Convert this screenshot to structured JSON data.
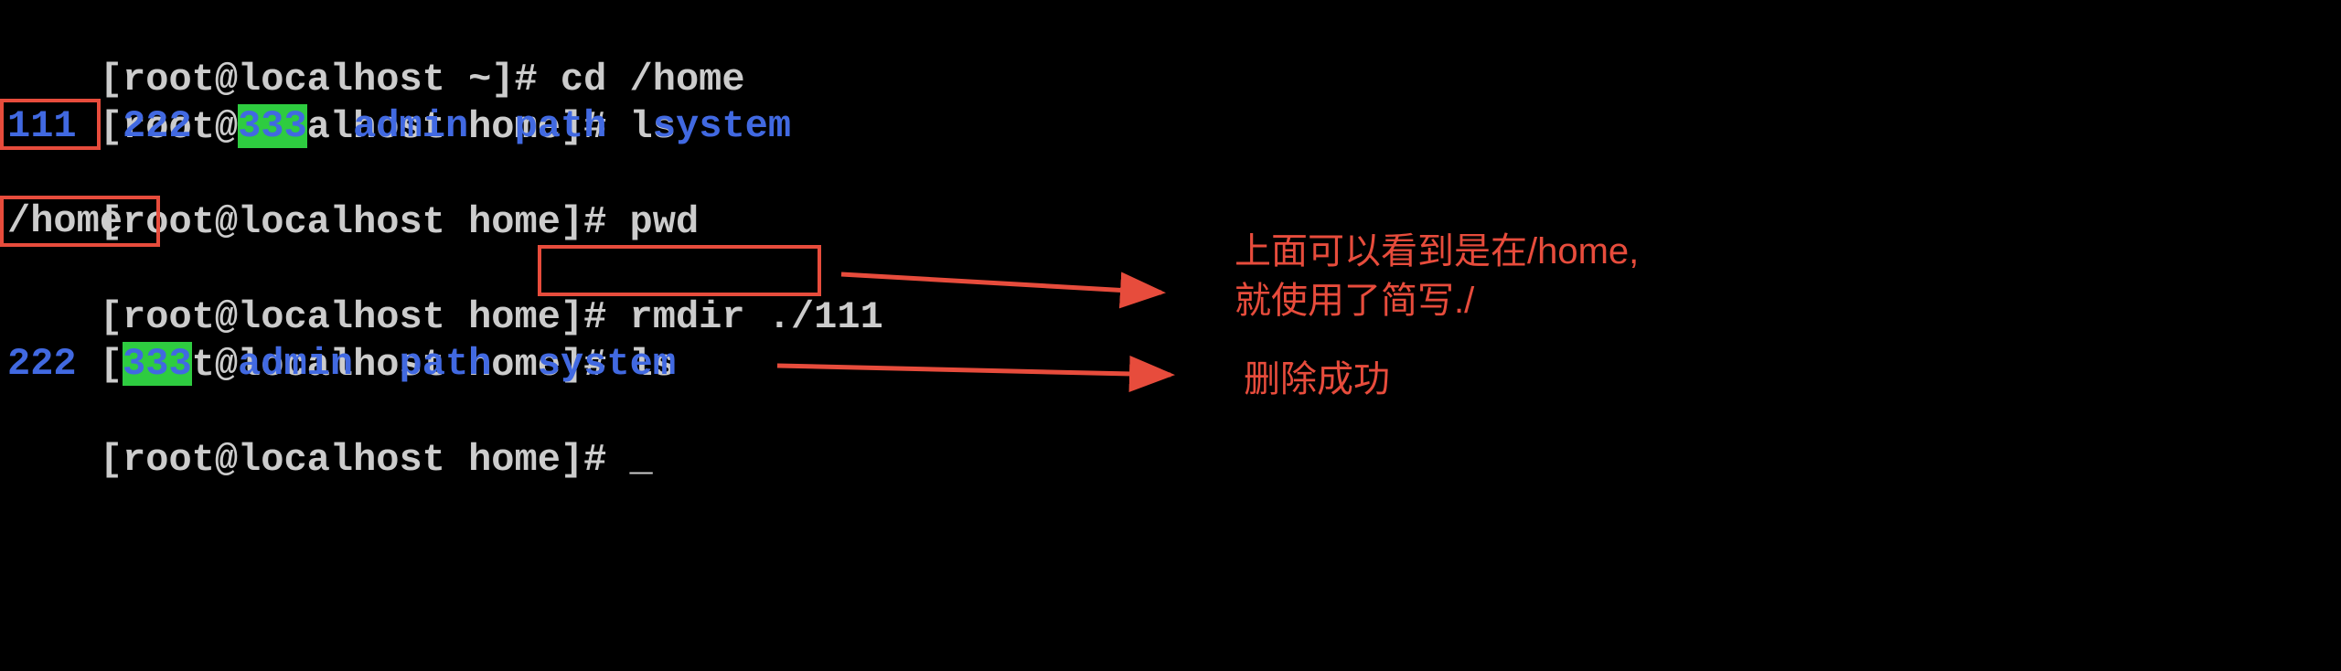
{
  "lines": {
    "l1_prompt": "[root@localhost ~]# ",
    "l1_cmd": "cd /home",
    "l2_prompt": "[root@localhost home]# ",
    "l2_cmd": "ls",
    "l3_111": "111",
    "l3_sp1": "  ",
    "l3_222": "222",
    "l3_sp2": "  ",
    "l3_333": "333",
    "l3_sp3": "  ",
    "l3_admin": "admin",
    "l3_sp4": "  ",
    "l3_path": "path",
    "l3_sp5": "  ",
    "l3_system": "system",
    "l4_prompt": "[root@localhost home]# ",
    "l4_cmd": "pwd",
    "l5_pwd": "/home",
    "l6_prompt": "[root@localhost home]# ",
    "l6_cmd": "rmdir ./111",
    "l7_prompt": "[root@localhost home]# ",
    "l7_cmd": "ls",
    "l8_222": "222",
    "l8_sp1": "  ",
    "l8_333": "333",
    "l8_sp2": "  ",
    "l8_admin": "admin",
    "l8_sp3": "  ",
    "l8_path": "path",
    "l8_sp4": "  ",
    "l8_system": "system",
    "l9_prompt": "[root@localhost home]# ",
    "l9_cursor": "_"
  },
  "annotations": {
    "note1_line1": "上面可以看到是在/home,",
    "note1_line2": "就使用了简写./",
    "note2": "删除成功"
  }
}
